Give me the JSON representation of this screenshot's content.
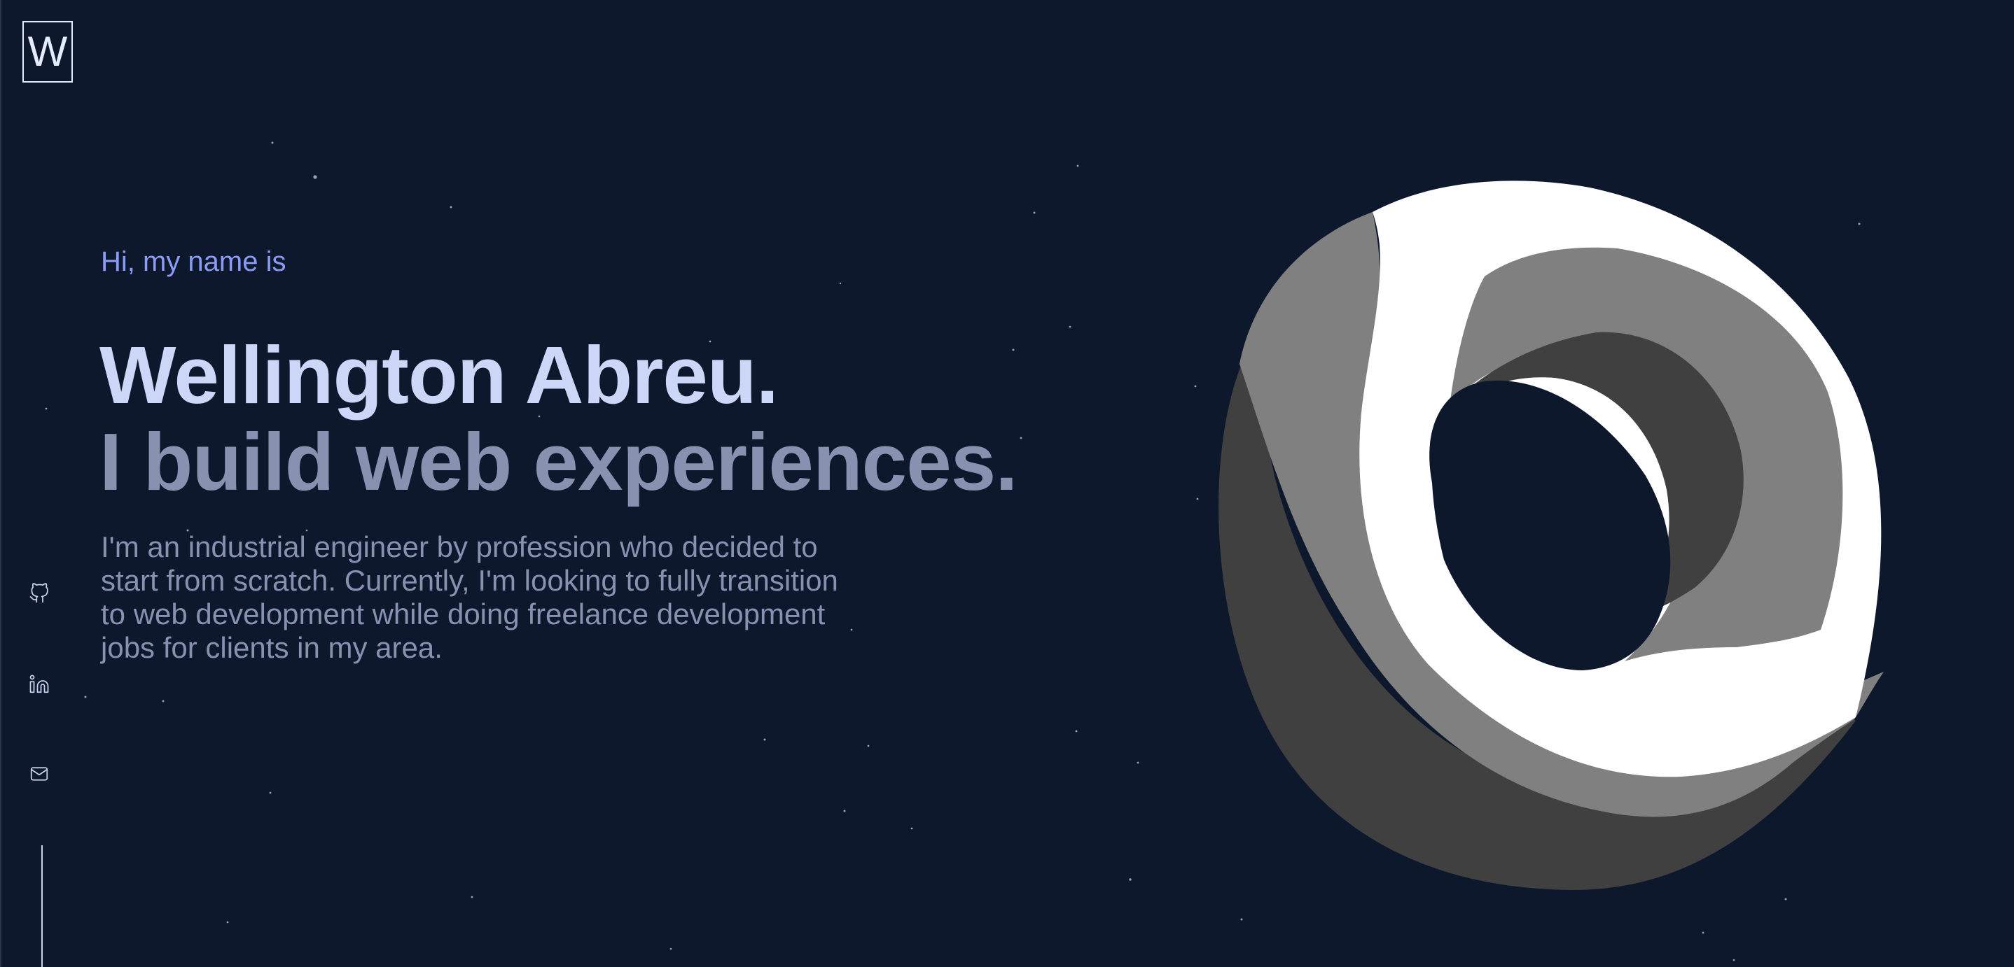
{
  "logo": {
    "letter": "W"
  },
  "hero": {
    "greeting": "Hi, my name is",
    "name": "Wellington Abreu.",
    "tagline": "I build web experiences.",
    "bio": "I'm an industrial engineer by profession who decided to start from scratch. Currently, I'm looking to fully transition to web development while doing freelance development jobs for clients in my area."
  },
  "social": [
    {
      "icon": "github-icon"
    },
    {
      "icon": "linkedin-icon"
    },
    {
      "icon": "mail-icon"
    }
  ],
  "colors": {
    "background": "#0e182d",
    "accent": "#8c9bf5",
    "heading": "#ccd6f6",
    "muted": "#8892b0",
    "torus_light": "#ffffff",
    "torus_mid": "#808080",
    "torus_dark": "#404040"
  }
}
